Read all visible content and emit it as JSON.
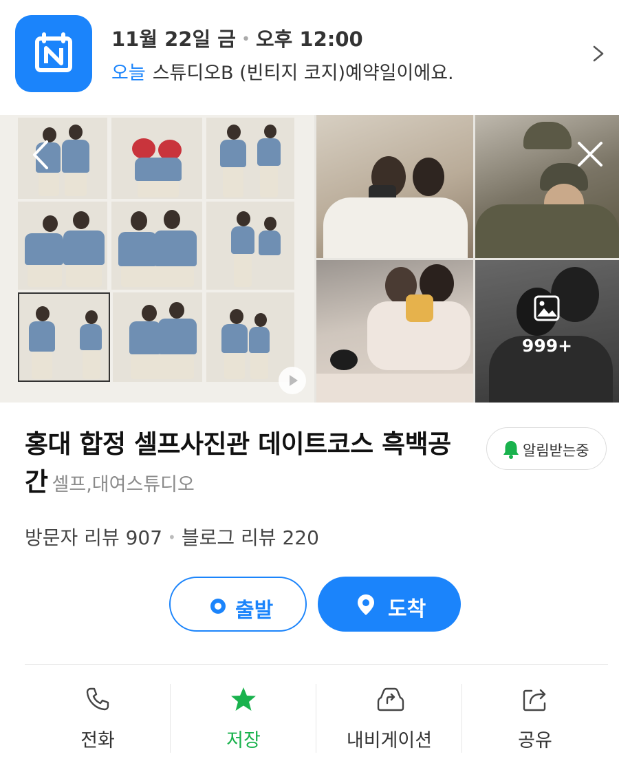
{
  "banner": {
    "icon": "calendar-n-icon",
    "date": "11월 22일 금",
    "time": "오후 12:00",
    "today_label": "오늘",
    "message": "스튜디오B (빈티지 코지)예약일이에요.",
    "accent": "#1b84fb"
  },
  "gallery": {
    "more_count": "999+",
    "icons": [
      "chevron-left-icon",
      "close-icon",
      "play-icon",
      "image-icon"
    ]
  },
  "place": {
    "name": "홍대 합정 셀프사진관 데이트코스 흑백공간",
    "category": "셀프,대여스튜디오",
    "alarm_label": "알림받는중",
    "visitor_reviews": "방문자 리뷰 907",
    "blog_reviews": "블로그 리뷰 220"
  },
  "route": {
    "depart_label": "출발",
    "arrive_label": "도착"
  },
  "actions": [
    {
      "label": "전화",
      "icon": "phone-icon"
    },
    {
      "label": "저장",
      "icon": "star-icon",
      "active": true,
      "color": "#19b24d"
    },
    {
      "label": "내비게이션",
      "icon": "car-navigation-icon"
    },
    {
      "label": "공유",
      "icon": "share-icon"
    }
  ]
}
